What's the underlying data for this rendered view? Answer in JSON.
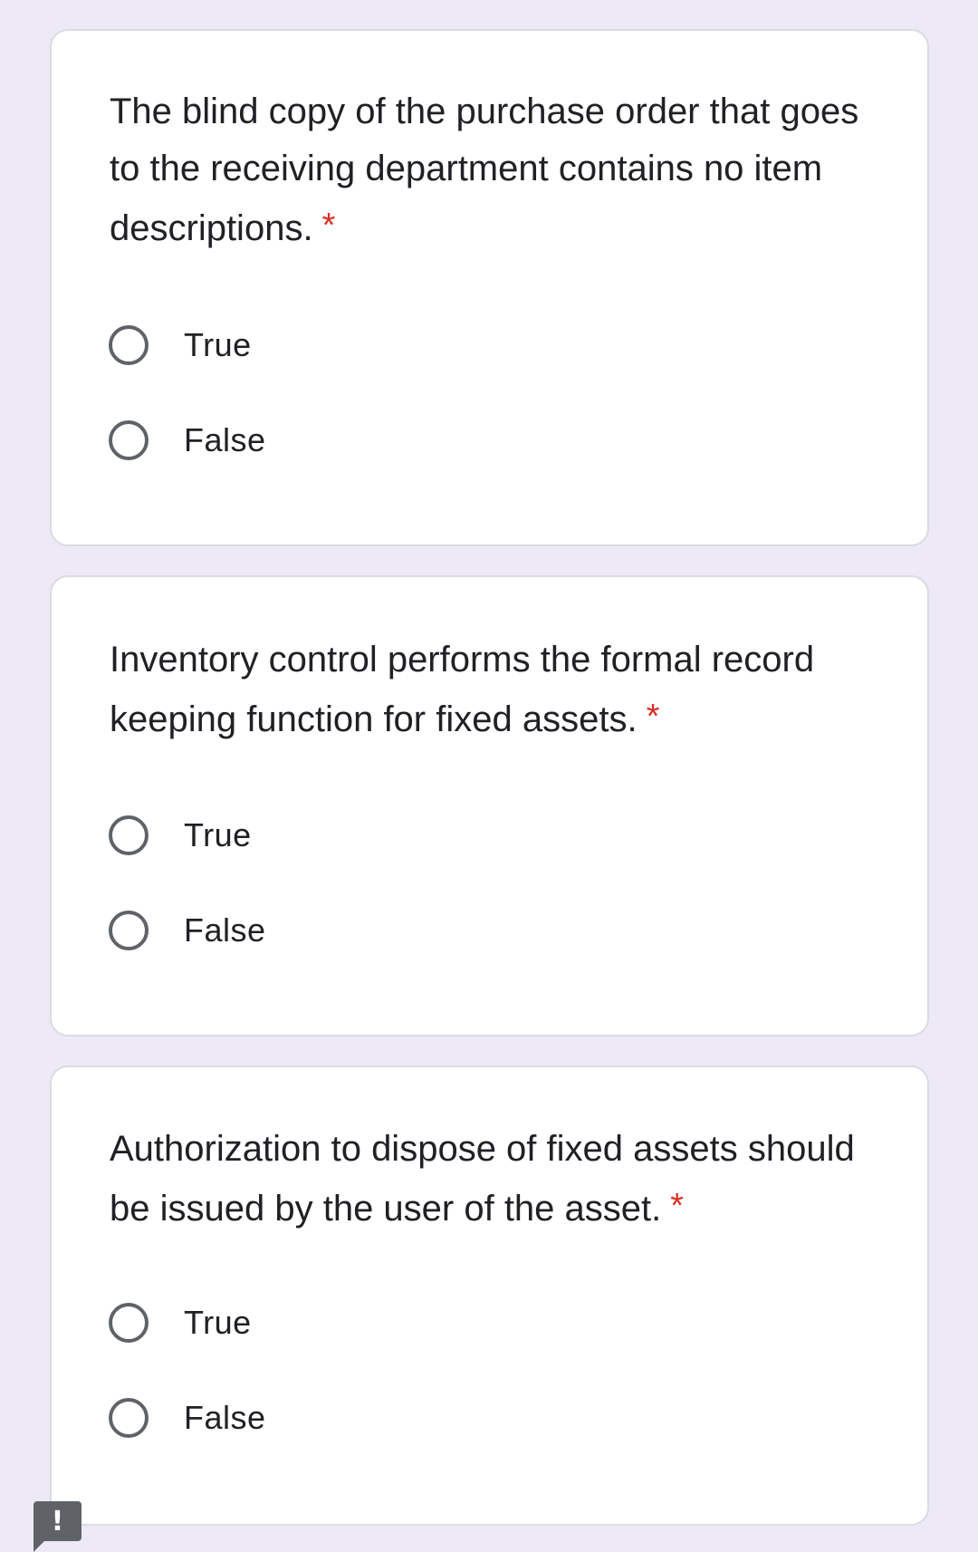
{
  "questions": [
    {
      "text": "The blind copy of the purchase order that goes to the receiving department contains no item descriptions.",
      "required_mark": "*",
      "options": [
        "True",
        "False"
      ]
    },
    {
      "text": "Inventory control performs the formal record keeping function for fixed assets.",
      "required_mark": "*",
      "options": [
        "True",
        "False"
      ]
    },
    {
      "text": "Authorization to dispose of fixed assets should be issued by the user of the asset.",
      "required_mark": "*",
      "options": [
        "True",
        "False"
      ]
    }
  ],
  "feedback_button": {
    "label": "!"
  },
  "colors": {
    "background": "#ede9f7",
    "card": "#ffffff",
    "required": "#d93025",
    "radio_border": "#5f6368"
  }
}
